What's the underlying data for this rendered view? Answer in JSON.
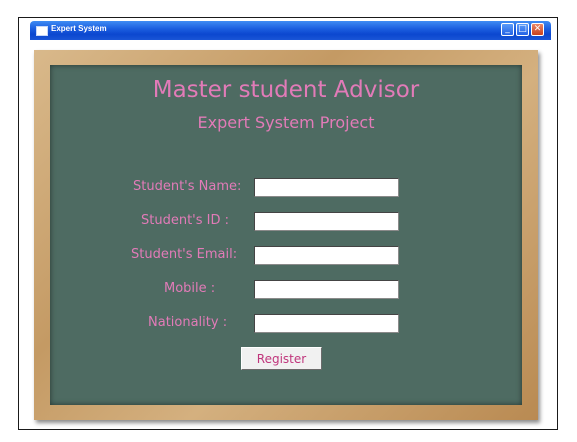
{
  "window": {
    "title": "Expert System",
    "minimize_glyph": "_",
    "maximize_glyph": "□",
    "close_glyph": "✕"
  },
  "board": {
    "title": "Master student Advisor",
    "subtitle": "Expert System Project"
  },
  "form": {
    "fields": [
      {
        "label": "Student's Name:",
        "value": ""
      },
      {
        "label": "Student's ID :",
        "value": ""
      },
      {
        "label": "Student's Email:",
        "value": ""
      },
      {
        "label": "Mobile :",
        "value": ""
      },
      {
        "label": "Nationality :",
        "value": ""
      }
    ],
    "register_label": "Register"
  },
  "colors": {
    "board_green": "#4e6b62",
    "text_pink": "#e27bb8",
    "frame_wood": "#c49a64",
    "titlebar_blue": "#0b47cf"
  },
  "icons": [
    "window-app-icon",
    "minimize-icon",
    "maximize-icon",
    "close-icon"
  ]
}
